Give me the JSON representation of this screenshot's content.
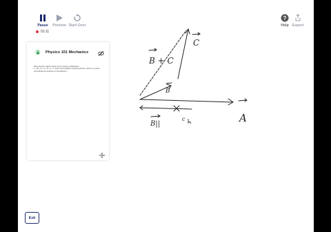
{
  "toolbar": {
    "pause_label": "Pause",
    "preview_label": "Preview",
    "start_over_label": "Start Over",
    "help_label": "Help",
    "export_label": "Export"
  },
  "timer": "01:11",
  "card": {
    "title": "Physics 101 Mechanics",
    "text_line1": "Show that the scalar product of two vectors is distributive:",
    "text_line2": "A · (B + C) = A · B + A · C. (Hint: Use a diagram showing all three vectors in a plane",
    "text_line3": "and indicate dot products on the diagram.)"
  },
  "drawing_labels": {
    "b_plus_c": "B + C",
    "c": "C",
    "b": "B",
    "a": "A",
    "b_parallel": "B||",
    "c_parallel": "c"
  },
  "exit_label": "Exit",
  "colors": {
    "accent": "#1d2a6e",
    "record": "#e0313b",
    "ink": "#1e1e1e"
  }
}
